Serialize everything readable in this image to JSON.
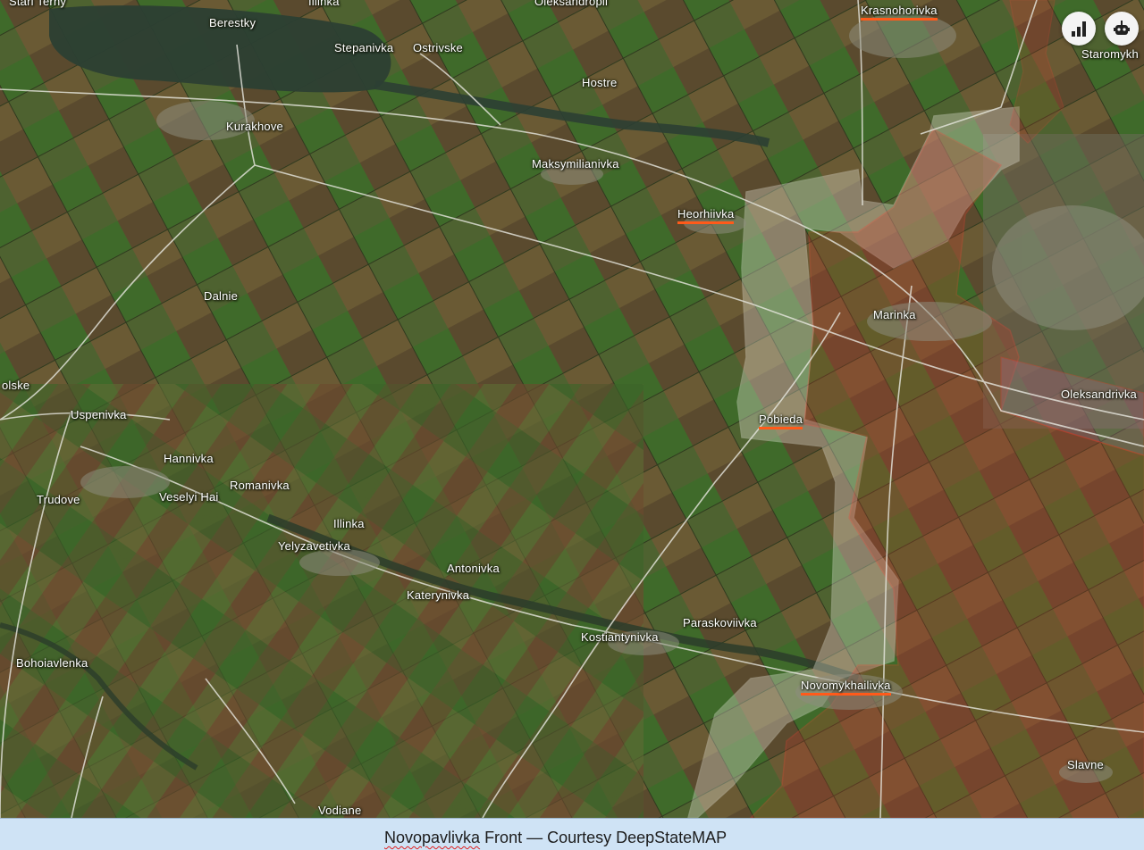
{
  "map": {
    "controls": [
      {
        "name": "stats-button",
        "icon": "bar-chart-icon"
      },
      {
        "name": "bot-button",
        "icon": "robot-icon"
      }
    ],
    "places": [
      {
        "id": "stari-terny",
        "text": "Stari Terny",
        "underlined": false
      },
      {
        "id": "illinka-top",
        "text": "Illinka",
        "underlined": false
      },
      {
        "id": "oleksandropil",
        "text": "Oleksandropil",
        "underlined": false
      },
      {
        "id": "krasnohorivka",
        "text": "Krasnohorivka",
        "underlined": true
      },
      {
        "id": "berestky",
        "text": "Berestky",
        "underlined": false
      },
      {
        "id": "stepanivka",
        "text": "Stepanivka",
        "underlined": false
      },
      {
        "id": "ostrivske",
        "text": "Ostrivske",
        "underlined": false
      },
      {
        "id": "hostre",
        "text": "Hostre",
        "underlined": false
      },
      {
        "id": "staromykhailivka",
        "text": "Staromykh",
        "underlined": false
      },
      {
        "id": "kurakhove",
        "text": "Kurakhove",
        "underlined": false
      },
      {
        "id": "maksymilianivka",
        "text": "Maksymilianivka",
        "underlined": false
      },
      {
        "id": "heorhiivka",
        "text": "Heorhiivka",
        "underlined": true
      },
      {
        "id": "dalnie",
        "text": "Dalnie",
        "underlined": false
      },
      {
        "id": "marinka",
        "text": "Marinka",
        "underlined": false
      },
      {
        "id": "oleksandrivka",
        "text": "Oleksandrivka",
        "underlined": false
      },
      {
        "id": "olske",
        "text": "olske",
        "underlined": false
      },
      {
        "id": "uspenivka",
        "text": "Uspenivka",
        "underlined": false
      },
      {
        "id": "pobieda",
        "text": "Pobieda",
        "underlined": true
      },
      {
        "id": "hannivka",
        "text": "Hannivka",
        "underlined": false
      },
      {
        "id": "romanivka",
        "text": "Romanivka",
        "underlined": false
      },
      {
        "id": "trudove",
        "text": "Trudove",
        "underlined": false
      },
      {
        "id": "veselyi-hai",
        "text": "Veselyi Hai",
        "underlined": false
      },
      {
        "id": "illinka",
        "text": "Illinka",
        "underlined": false
      },
      {
        "id": "yelyzavetivka",
        "text": "Yelyzavetivka",
        "underlined": false
      },
      {
        "id": "antonivka",
        "text": "Antonivka",
        "underlined": false
      },
      {
        "id": "katerynivka",
        "text": "Katerynivka",
        "underlined": false
      },
      {
        "id": "paraskoviivka",
        "text": "Paraskoviivka",
        "underlined": false
      },
      {
        "id": "kostiantynivka",
        "text": "Kostiantynivka",
        "underlined": false
      },
      {
        "id": "bohoiavlenka",
        "text": "Bohoiavlenka",
        "underlined": false
      },
      {
        "id": "novomykhailivka",
        "text": "Novomykhailivka",
        "underlined": true
      },
      {
        "id": "slavne",
        "text": "Slavne",
        "underlined": false
      },
      {
        "id": "vodiane",
        "text": "Vodiane",
        "underlined": true
      }
    ],
    "colors": {
      "occupied_fill": "#c0392b",
      "occupied_border": "#ff3b2f",
      "contested_fill": "#e6e6d6",
      "road": "#e8e8e0",
      "water": "#2c3f33",
      "underline": "#ff5a1a"
    }
  },
  "caption": {
    "underlined_word": "Novopavlivka",
    "rest": " Front — Courtesy DeepStateMAP"
  }
}
